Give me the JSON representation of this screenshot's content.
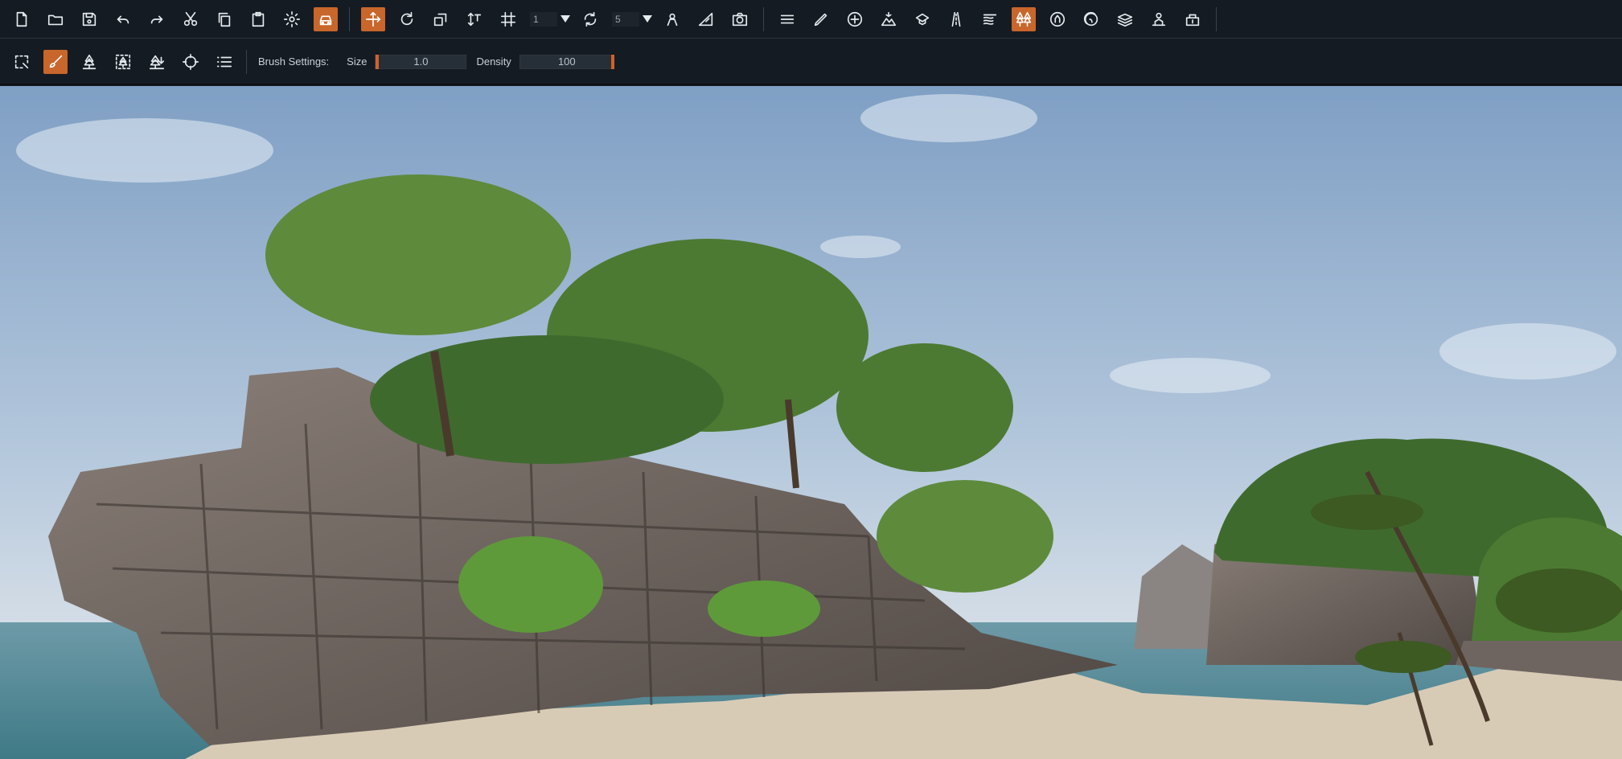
{
  "toolbar_main": {
    "icons": [
      "new-file-icon",
      "open-folder-icon",
      "save-icon",
      "undo-icon",
      "redo-icon",
      "cut-icon",
      "copy-icon",
      "paste-icon",
      "settings-gear-icon",
      "vehicle-icon"
    ],
    "tools": [
      "move-gizmo-icon",
      "rotate-icon",
      "scale-icon",
      "vertical-snap-icon",
      "grid-snap-icon"
    ],
    "grid_snap_value": "1",
    "rotation_snap_value": "5",
    "extra_tools": [
      "camera-speed-icon",
      "terrain-slope-icon",
      "screenshot-camera-icon"
    ],
    "editors": [
      "menu-list-icon",
      "pencil-edit-icon",
      "add-circle-icon",
      "terrain-sculpt-icon",
      "prefab-icon",
      "road-icon",
      "river-icon",
      "forest-icon",
      "environment-icon",
      "material-icon",
      "layers-icon",
      "ai-character-icon",
      "cargo-icon"
    ],
    "active_editor": "forest-icon"
  },
  "toolbar_brush": {
    "tools": [
      "selection-icon",
      "paint-brush-icon",
      "place-tree-icon",
      "erase-area-icon",
      "tree-fill-icon",
      "target-icon",
      "list-icon"
    ],
    "active_tool": "paint-brush-icon",
    "brush_settings_label": "Brush Settings:",
    "size_label": "Size",
    "size_value": "1.0",
    "density_label": "Density",
    "density_value": "100"
  },
  "colors": {
    "accent": "#c9662b",
    "toolbar_bg": "#151b22",
    "sky": "#8aa8c8",
    "sea": "#5a8c9c",
    "sand": "#d8cbb6",
    "rock": "#6f6560",
    "foliage": "#4c7a32"
  }
}
